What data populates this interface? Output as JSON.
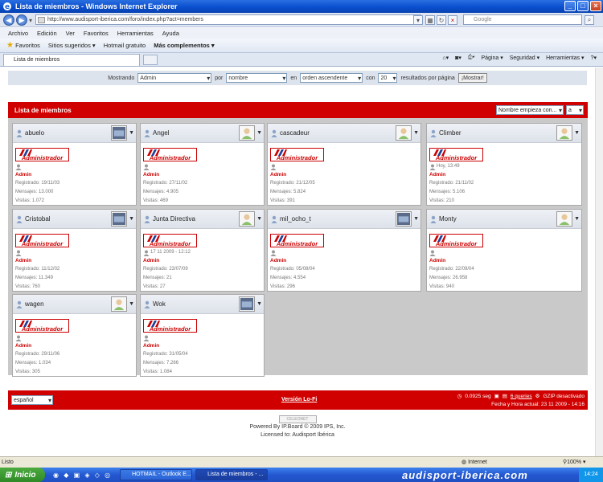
{
  "window": {
    "title": "Lista de miembros - Windows Internet Explorer"
  },
  "address": {
    "url": "http://www.audisport-iberica.com/foro/index.php?act=members",
    "search_placeholder": "Google"
  },
  "menu": [
    "Archivo",
    "Edición",
    "Ver",
    "Favoritos",
    "Herramientas",
    "Ayuda"
  ],
  "favorites": {
    "label": "Favoritos",
    "items": [
      "Sitios sugeridos ▾",
      "Hotmail gratuito",
      "Más complementos ▾"
    ]
  },
  "tab": {
    "label": "Lista de miembros"
  },
  "cmdbar": [
    "Página ▾",
    "Seguridad ▾",
    "Herramientas ▾"
  ],
  "filter": {
    "show_label": "Mostrando",
    "show_value": "Admin",
    "by_label": "por",
    "by_value": "nombre",
    "in_label": "en",
    "order_value": "orden ascendente",
    "with_label": "con",
    "count_value": "20",
    "results_label": "resultados por página",
    "button": "¡Mostrar!"
  },
  "members_header": {
    "title": "Lista de miembros",
    "starts_with": "Nombre empieza con...",
    "letter": "a"
  },
  "badge_text": "Administrador",
  "members": [
    {
      "name": "abuelo",
      "online": "",
      "role": "Admin",
      "registered": "Registrado: 19/11/03",
      "messages": "Mensajes: 13.000",
      "visits": "Visitas: 1.072"
    },
    {
      "name": "Angel",
      "online": "",
      "role": "Admin",
      "registered": "Registrado: 27/11/02",
      "messages": "Mensajes: 4.905",
      "visits": "Visitas: 469"
    },
    {
      "name": "cascadeur",
      "online": "",
      "role": "Admin",
      "registered": "Registrado: 21/12/05",
      "messages": "Mensajes: 5.824",
      "visits": "Visitas: 391"
    },
    {
      "name": "Climber",
      "online": "Hoy, 13:49",
      "role": "Admin",
      "registered": "Registrado: 21/11/02",
      "messages": "Mensajes: 5.106",
      "visits": "Visitas: 210"
    },
    {
      "name": "Cristobal",
      "online": "",
      "role": "Admin",
      "registered": "Registrado: 11/12/02",
      "messages": "Mensajes: 11.349",
      "visits": "Visitas: 760"
    },
    {
      "name": "Junta Directiva",
      "online": "17 11 2009 - 12:12",
      "role": "Admin",
      "registered": "Registrado: 23/07/09",
      "messages": "Mensajes: 21",
      "visits": "Visitas: 27"
    },
    {
      "name": "mil_ocho_t",
      "online": "",
      "role": "Admin",
      "registered": "Registrado: 05/08/04",
      "messages": "Mensajes: 4.554",
      "visits": "Visitas: 296"
    },
    {
      "name": "Monty",
      "online": "",
      "role": "Admin",
      "registered": "Registrado: 22/09/04",
      "messages": "Mensajes: 26.958",
      "visits": "Visitas: 940"
    },
    {
      "name": "wagen",
      "online": "",
      "role": "Admin",
      "registered": "Registrado: 29/11/06",
      "messages": "Mensajes: 1.034",
      "visits": "Visitas: 305"
    },
    {
      "name": "Wok",
      "online": "",
      "role": "Admin",
      "registered": "Registrado: 31/05/04",
      "messages": "Mensajes: 7.266",
      "visits": "Visitas: 1.084"
    }
  ],
  "footer": {
    "language": "español",
    "lofi": "Versión Lo-Fi",
    "time": "0.0925 seg",
    "queries": "6 queries",
    "gzip": "GZIP desactivado",
    "date": "Fecha y Hora actual: 23 11 2009 - 14:16"
  },
  "credits": {
    "logo": "CELEONET",
    "line1": "Powered By IP.Board © 2009  IPS, Inc.",
    "line2": "Licensed to: Audisport Ibérica"
  },
  "status": {
    "text": "Listo",
    "zone": "Internet",
    "zoom": "100%"
  },
  "taskbar": {
    "start": "Inicio",
    "items": [
      "HOTMAIL - Outlook E...",
      "Lista de miembros - ..."
    ],
    "brand": "audisport-iberica.com",
    "clock": "14:24"
  }
}
